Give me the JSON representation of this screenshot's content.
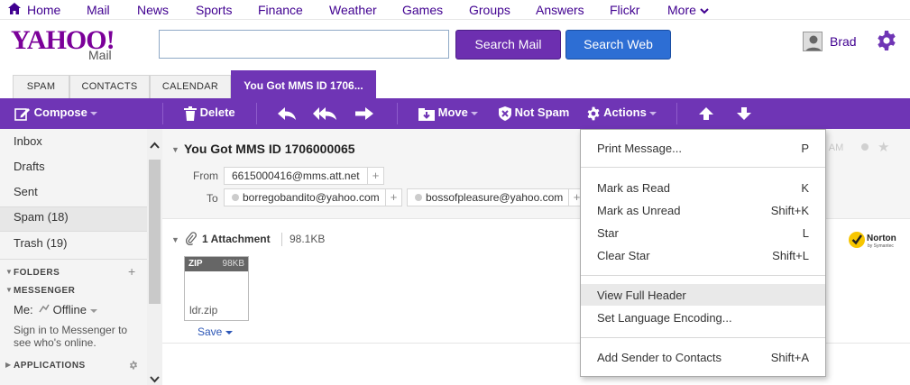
{
  "topnav": {
    "home": "Home",
    "mail": "Mail",
    "news": "News",
    "sports": "Sports",
    "finance": "Finance",
    "weather": "Weather",
    "games": "Games",
    "groups": "Groups",
    "answers": "Answers",
    "flickr": "Flickr",
    "more": "More"
  },
  "header": {
    "logo_text": "YAHOO!",
    "logo_sub": "Mail",
    "search_placeholder": "",
    "search_mail_label": "Search Mail",
    "search_web_label": "Search Web",
    "user_name": "Brad"
  },
  "tabs": [
    {
      "label": "SPAM"
    },
    {
      "label": "CONTACTS"
    },
    {
      "label": "CALENDAR"
    },
    {
      "label": "You Got MMS ID 1706..."
    }
  ],
  "toolbar": {
    "compose": "Compose",
    "delete": "Delete",
    "move": "Move",
    "not_spam": "Not Spam",
    "actions": "Actions"
  },
  "sidebar": {
    "items": [
      {
        "label": "Inbox"
      },
      {
        "label": "Drafts"
      },
      {
        "label": "Sent"
      },
      {
        "label": "Spam (18)"
      },
      {
        "label": "Trash (19)"
      }
    ],
    "folders_title": "FOLDERS",
    "messenger_title": "MESSENGER",
    "me_label": "Me:",
    "status": "Offline",
    "messenger_hint": "Sign in to Messenger to see who's online.",
    "applications_title": "APPLICATIONS"
  },
  "message": {
    "subject": "You Got MMS ID 1706000065",
    "from_label": "From",
    "from": "6615000416@mms.att.net",
    "to_label": "To",
    "to": [
      "borregobandito@yahoo.com",
      "bossofpleasure@yahoo.com"
    ],
    "date_fragment": "Fri, Jul 18, 2014 8:29 AM",
    "attachment_title": "1 Attachment",
    "attachment_size": "98.1KB",
    "file_type": "ZIP",
    "file_size": "98KB",
    "file_name": "ldr.zip",
    "save_label": "Save"
  },
  "actions_menu": {
    "groups": [
      [
        {
          "label": "Print Message...",
          "shortcut": "P"
        }
      ],
      [
        {
          "label": "Mark as Read",
          "shortcut": "K"
        },
        {
          "label": "Mark as Unread",
          "shortcut": "Shift+K"
        },
        {
          "label": "Star",
          "shortcut": "L"
        },
        {
          "label": "Clear Star",
          "shortcut": "Shift+L"
        }
      ],
      [
        {
          "label": "View Full Header",
          "shortcut": ""
        },
        {
          "label": "Set Language Encoding...",
          "shortcut": ""
        }
      ],
      [
        {
          "label": "Add Sender to Contacts",
          "shortcut": "Shift+A"
        }
      ]
    ]
  },
  "colors": {
    "brand_purple": "#6f35b5",
    "search_mail": "#6d2fb0",
    "search_web": "#2d6ed4",
    "nav_text": "#400090"
  }
}
